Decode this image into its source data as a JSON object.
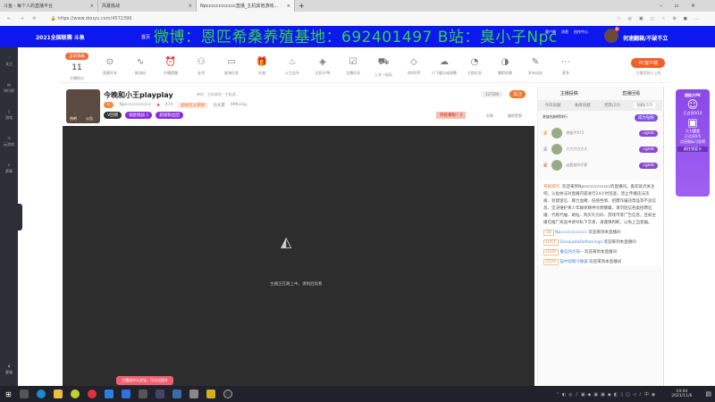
{
  "browser": {
    "tabs": [
      "斗鱼 - 每个人的直播平台",
      "风暴挑战",
      "Npcccccccccccc直播_主机其他游戏..."
    ],
    "url": "https://www.douyu.com/4572396"
  },
  "header": {
    "logo": "2021全国联赛 斗鱼",
    "nav": [
      "首页",
      "分类"
    ],
    "overlay": "微博：恩匹希桑养殖基地：692401497 B站：臭小子Npc",
    "right_items": [
      "历史",
      "关注",
      "开播",
      "客户端",
      "消息",
      "创作中心"
    ],
    "user": "何速翻箱/不破不立",
    "badge_count": "9"
  },
  "sidebar": [
    "关注",
    "排行榜",
    "游戏",
    "云游戏",
    "赛事",
    "客服"
  ],
  "toolbar": {
    "level_badge": "当前等级",
    "level": "11",
    "level_label": "主播积分",
    "items": [
      "直播开关",
      "推流码",
      "开播提醒",
      "友邻",
      "星海任务",
      "礼物",
      "火力全开",
      "全民乐PK",
      "主播任务",
      "上车一起玩",
      "房间VIP",
      "小飞碟分成调整",
      "大航任务",
      "兼职招募",
      "发布动态",
      "更多"
    ],
    "pc_button": "PC客户端",
    "pc_sub": "主播定制已上线"
  },
  "room": {
    "title": "今晚和小王playplay",
    "category": "单机 · 主机其他 · 主机游...",
    "anchor": "Npcccccccccccc",
    "hot": "474",
    "tag": "超级巨头萌新",
    "contribution": "也太累",
    "weight": "999+kg",
    "avatar_labels": [
      "热吧",
      "公告"
    ],
    "badges": [
      "V回增",
      "福星挑战 1",
      "超级粉丝团"
    ],
    "follow_count": "337296",
    "follow": "关注",
    "share": "分享",
    "report": "福利签到",
    "banner": "开抢来啦！2"
  },
  "video": {
    "status": "主播正在路上中，请稍后观看",
    "toast": "主播送你九房宝，可点击提升"
  },
  "chat": {
    "top": [
      "主播投稿",
      "直播回看"
    ],
    "tabs": [
      "今日贡献",
      "本周贡献",
      "贵宾(24)",
      "钻粉(57)"
    ],
    "rank_title": "贵族钻粉榜排行",
    "join": "成为钻粉",
    "ranks": [
      {
        "name": "突破手X75",
        "tag": "cgmb"
      },
      {
        "name": "大大力力大大",
        "tag": "cgmb"
      },
      {
        "name": "@超紧凹仔郭",
        "tag": "cgmb"
      }
    ],
    "system_label": "系统提示:",
    "system": "欢迎来到Npcccccccccccc的直播间。喜欢就点关注吧。斗鱼依法对直播内容进行24小时巡查，禁止传播违法违规、封建迷信、暴力血腥、低俗色情、招嫖诈骗违禁品等不良信息，坚决维护青少年群体精神文明健康。请勿轻信各类招聘征婚、代练代抽、刷钻、购买礼包码、游戏币等广告信息。且如主播在推广商品中诱导私下交易，请谨慎判断，以免上当受骗。",
    "entries": [
      {
        "lv": "18",
        "user": "Npcccccccccccc",
        "text": "欢迎来到本直播间"
      },
      {
        "lv": "LV11",
        "user": "DonquateDoflamingo",
        "text": "欢迎来到本直播间"
      },
      {
        "lv": "LV20",
        "user": "番茄炖大锅~",
        "text": "欢迎来到本直播间"
      },
      {
        "lv": "LV20",
        "user": "猫中观察冷静器",
        "text": "欢迎来到本直播间"
      }
    ]
  },
  "ad": {
    "title": "超级大PK",
    "lines": [
      "已点亮0/10",
      "大力魔盒",
      "已点亮0/5",
      "点亮图标可获得",
      "前往领奖卡"
    ]
  },
  "taskbar": {
    "time": "19:04",
    "date": "2021/11/6"
  }
}
